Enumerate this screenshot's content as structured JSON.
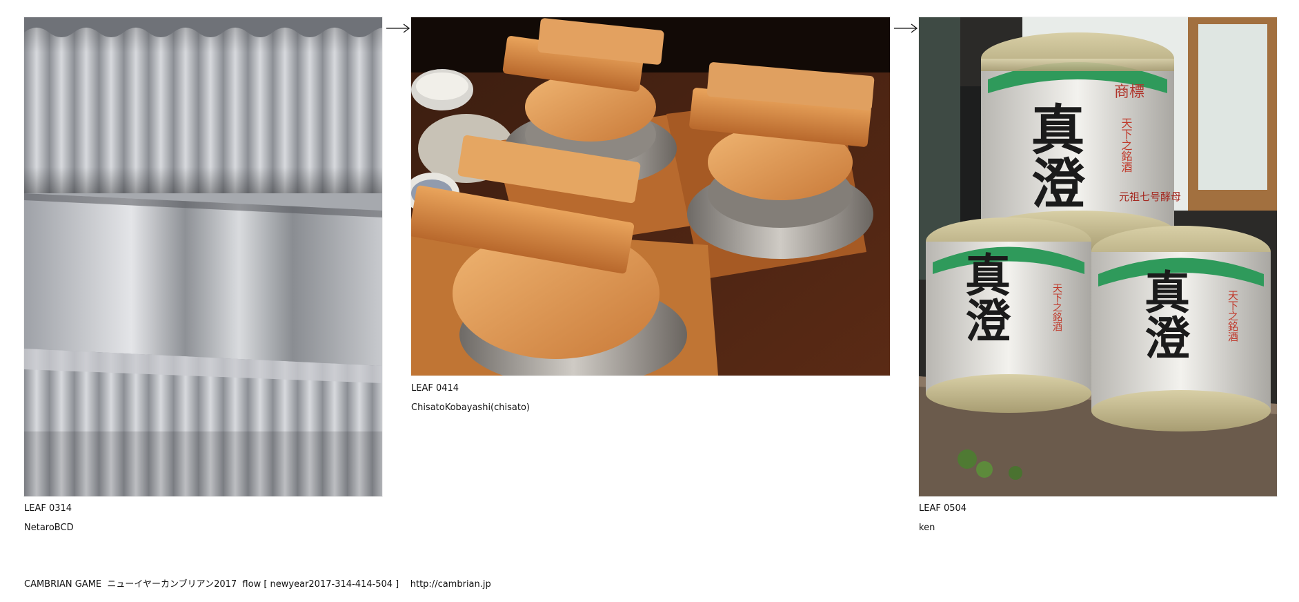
{
  "leaves": [
    {
      "title": "LEAF 0314",
      "author": "NetaroBCD",
      "subject": "corrugated metal sheets"
    },
    {
      "title": "LEAF 0414",
      "author": "ChisatoKobayashi(chisato)",
      "subject": "wooden-lidded rice pots"
    },
    {
      "title": "LEAF 0504",
      "author": "ken",
      "subject": "stacked sake barrels",
      "barrel_text": {
        "brand": "真澄",
        "trademark": "商標",
        "label": "天下之銘酒",
        "maker": "元祖七号酵母"
      }
    }
  ],
  "arrows": [
    "right-arrow-icon",
    "right-arrow-icon"
  ],
  "footer": {
    "text": "CAMBRIAN GAME  ニューイヤーカンブリアン2017  flow [ newyear2017-314-414-504 ]    http://cambrian.jp"
  },
  "colors": {
    "background": "#ffffff",
    "text": "#111111"
  }
}
